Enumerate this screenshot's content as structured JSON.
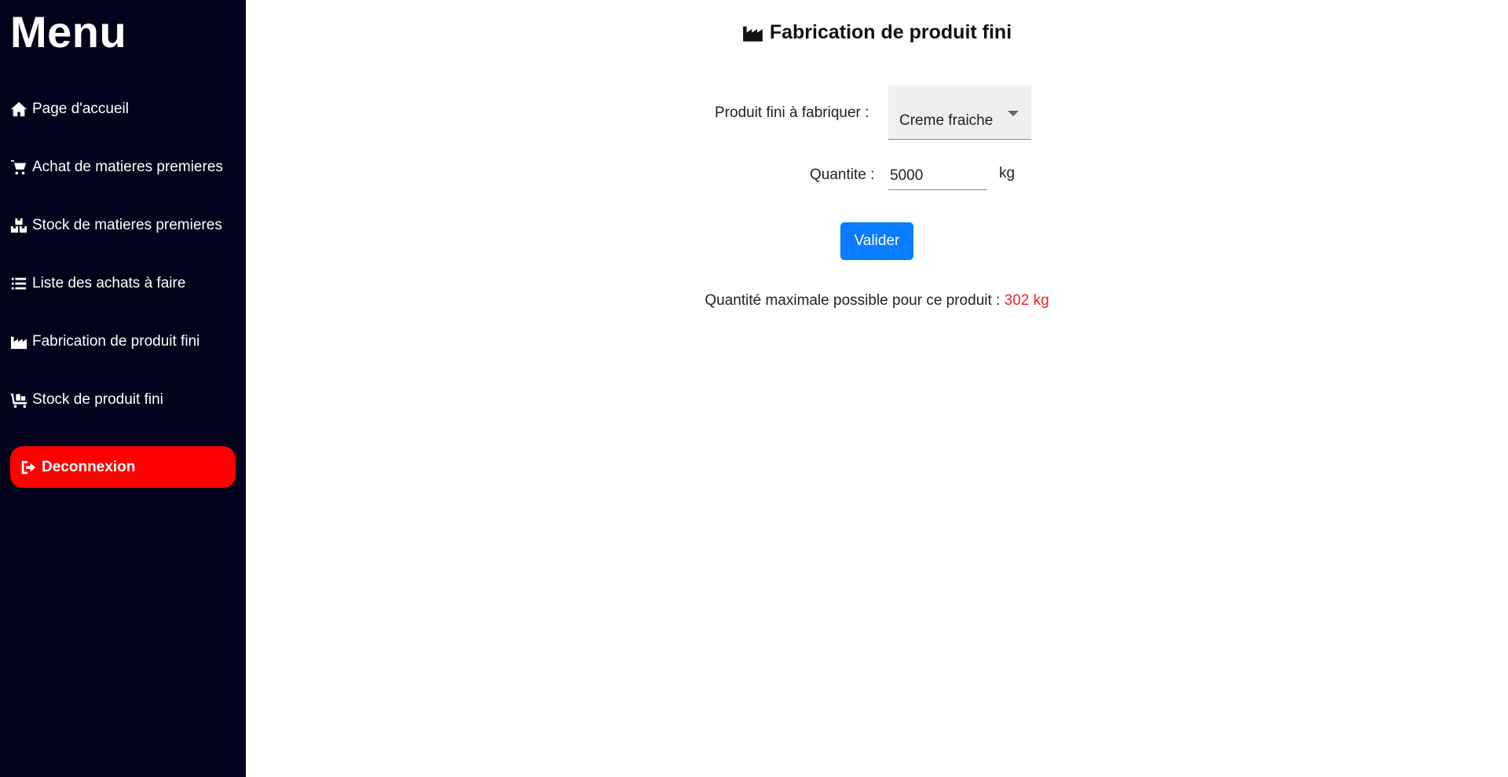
{
  "sidebar": {
    "title": "Menu",
    "items": [
      {
        "label": "Page d'accueil",
        "icon": "home-icon"
      },
      {
        "label": "Achat de matieres premieres",
        "icon": "cart-icon"
      },
      {
        "label": "Stock de matieres premieres",
        "icon": "boxes-icon"
      },
      {
        "label": "Liste des achats à faire",
        "icon": "list-icon"
      },
      {
        "label": "Fabrication de produit fini",
        "icon": "industry-icon"
      },
      {
        "label": "Stock de produit fini",
        "icon": "dolly-icon"
      }
    ],
    "logout": {
      "label": "Deconnexion",
      "icon": "sign-out-icon",
      "color": "#ff0000"
    },
    "background": "#02021a"
  },
  "main": {
    "title": "Fabrication de produit fini",
    "title_icon": "industry-icon",
    "product": {
      "label": "Produit fini à fabriquer :",
      "value": "Creme fraiche"
    },
    "quantity": {
      "label": "Quantite :",
      "value": "5000",
      "unit": "kg"
    },
    "submit_label": "Valider",
    "submit_color": "#0a7cff",
    "max_info": {
      "label": "Quantité maximale possible pour ce produit :",
      "value": "302 kg",
      "value_color": "#e8232a"
    }
  }
}
